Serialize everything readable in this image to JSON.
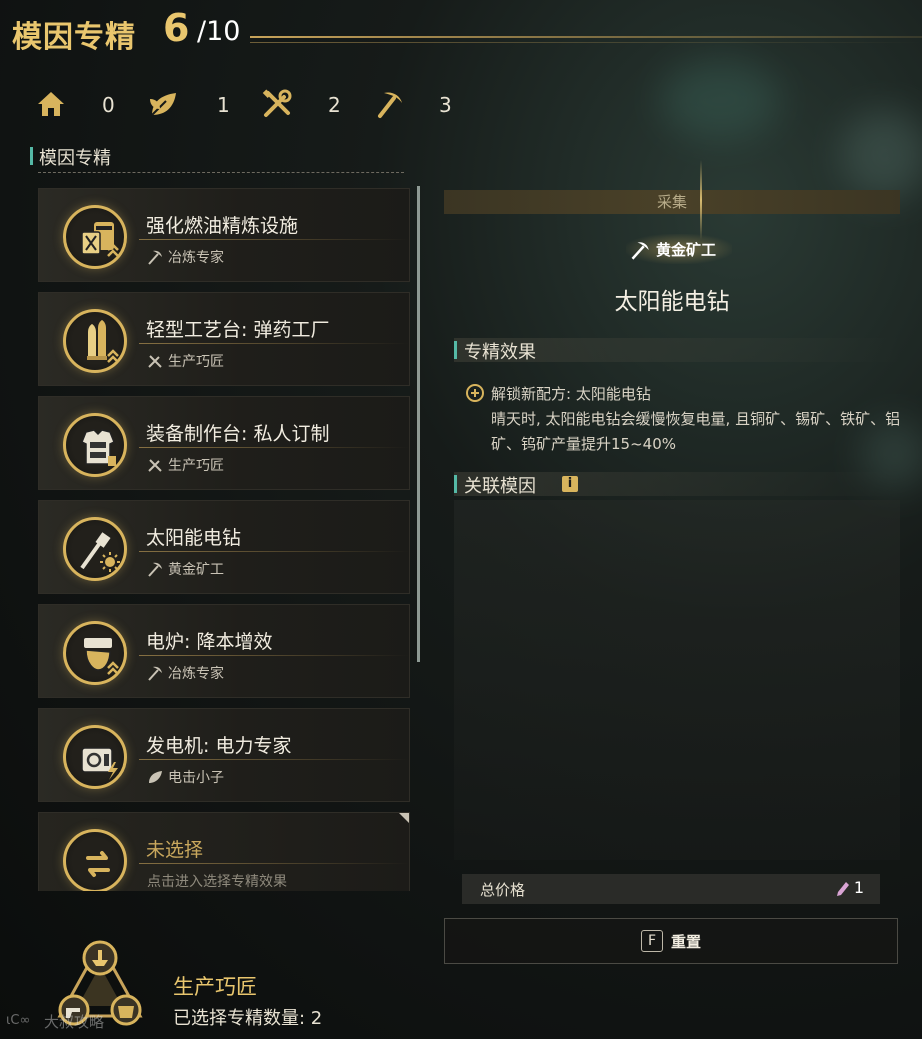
{
  "header": {
    "title": "模因专精",
    "selected_count": "6",
    "total": "/10"
  },
  "categories": [
    {
      "icon": "house-icon",
      "count": "0"
    },
    {
      "icon": "leaf-icon",
      "count": "1"
    },
    {
      "icon": "tools-icon",
      "count": "2"
    },
    {
      "icon": "pickaxe-icon",
      "count": "3"
    }
  ],
  "list_heading": "模因专精",
  "items": [
    {
      "name": "强化燃油精炼设施",
      "sub": "冶炼专家",
      "icon": "fuel-tank-icon",
      "sub_icon": "pickaxe-icon"
    },
    {
      "name": "轻型工艺台: 弹药工厂",
      "sub": "生产巧匠",
      "icon": "ammo-icon",
      "sub_icon": "tools-icon"
    },
    {
      "name": "装备制作台: 私人订制",
      "sub": "生产巧匠",
      "icon": "armor-icon",
      "sub_icon": "tools-icon"
    },
    {
      "name": "太阳能电钻",
      "sub": "黄金矿工",
      "icon": "solar-drill-icon",
      "sub_icon": "pickaxe-icon"
    },
    {
      "name": "电炉: 降本增效",
      "sub": "冶炼专家",
      "icon": "furnace-icon",
      "sub_icon": "pickaxe-icon"
    },
    {
      "name": "发电机: 电力专家",
      "sub": "电击小子",
      "icon": "generator-icon",
      "sub_icon": "leaf-icon"
    },
    {
      "name": "未选择",
      "sub": "点击进入选择专精效果",
      "icon": "swap-icon",
      "sub_icon": ""
    }
  ],
  "detail": {
    "category": "采集",
    "tag": "黄金矿工",
    "title": "太阳能电钻",
    "effect_heading": "专精效果",
    "effect_title": "解锁新配方: 太阳能电钻",
    "effect_desc": "晴天时, 太阳能电钻会缓慢恢复电量, 且铜矿、锡矿、铁矿、铝矿、钨矿产量提升15~40%",
    "related_heading": "关联模因",
    "info_icon": "i",
    "price_label": "总价格",
    "price_value": "1"
  },
  "reset": {
    "key": "F",
    "label": "重置"
  },
  "summary": {
    "title": "生产巧匠",
    "subtitle": "已选择专精数量: 2"
  },
  "watermark": "大叔攻略",
  "colors": {
    "gold": "#e9c66e",
    "teal_accent": "#55b9a6",
    "background": "#121514"
  }
}
